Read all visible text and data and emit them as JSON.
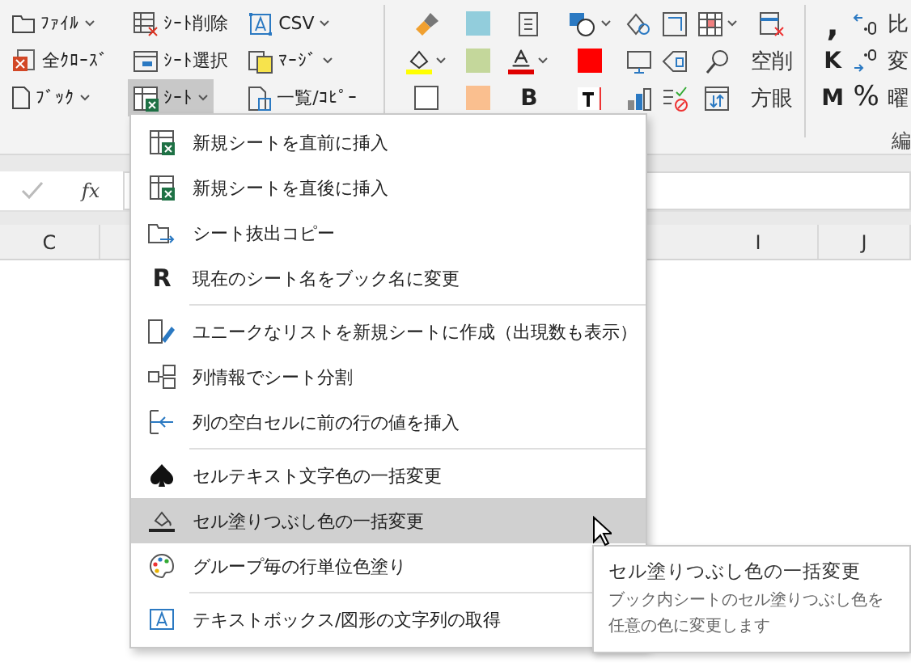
{
  "ribbon": {
    "groups": [
      {
        "buttons": [
          {
            "label": "ﾌｧｲﾙ",
            "dropdown": true,
            "selected": false
          },
          {
            "label": "全ｸﾛｰｽﾞ",
            "dropdown": false,
            "selected": false
          },
          {
            "label": "ﾌﾞｯｸ",
            "dropdown": true,
            "selected": false
          }
        ]
      },
      {
        "buttons": [
          {
            "label": "ｼｰﾄ削除",
            "dropdown": false,
            "selected": false
          },
          {
            "label": "ｼｰﾄ選択",
            "dropdown": false,
            "selected": false
          },
          {
            "label": "ｼｰﾄ",
            "dropdown": true,
            "selected": true
          }
        ]
      },
      {
        "buttons": [
          {
            "label": "CSV",
            "dropdown": true,
            "selected": false
          },
          {
            "label": "ﾏｰｼﾞ",
            "dropdown": true,
            "selected": false
          },
          {
            "label": "一覧/ｺﾋﾟｰ",
            "dropdown": false,
            "selected": false
          }
        ]
      }
    ],
    "bold_glyph": "B",
    "text_buttons": [
      "空削",
      "方眼"
    ],
    "number_glyphs": [
      ",",
      "K",
      "M"
    ],
    "percent_glyph": "%",
    "cut_labels": [
      "比",
      "変",
      "曜"
    ],
    "group_label": "編"
  },
  "formula_bar": {
    "fx": "fx"
  },
  "columns": [
    "C",
    "I",
    "J"
  ],
  "menu": {
    "sections": [
      {
        "items": [
          {
            "label": "新規シートを直前に挿入",
            "selected": false
          },
          {
            "label": "新規シートを直後に挿入",
            "selected": false
          },
          {
            "label": "シート抜出コピー",
            "selected": false
          },
          {
            "label": "現在のシート名をブック名に変更",
            "glyph": "R",
            "selected": false
          }
        ]
      },
      {
        "items": [
          {
            "label": "ユニークなリストを新規シートに作成（出現数も表示）",
            "selected": false
          },
          {
            "label": "列情報でシート分割",
            "selected": false
          },
          {
            "label": "列の空白セルに前の行の値を挿入",
            "selected": false
          }
        ]
      },
      {
        "items": [
          {
            "label": "セルテキスト文字色の一括変更",
            "selected": false
          },
          {
            "label": "セル塗りつぶし色の一括変更",
            "selected": true
          },
          {
            "label": "グループ毎の行単位色塗り",
            "selected": false
          }
        ]
      },
      {
        "items": [
          {
            "label": "テキストボックス/図形の文字列の取得",
            "selected": false
          }
        ]
      }
    ]
  },
  "tooltip": {
    "title": "セル塗りつぶし色の一括変更",
    "lines": [
      "ブック内シートのセル塗りつぶし色を",
      "任意の色に変更します"
    ]
  }
}
